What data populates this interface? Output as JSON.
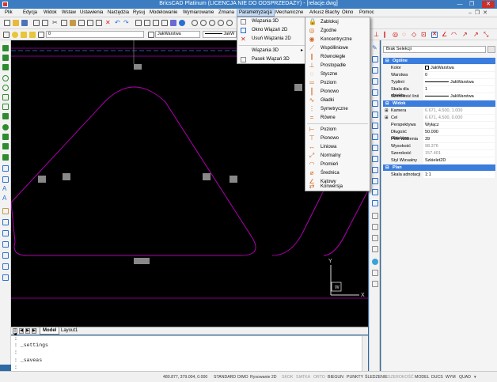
{
  "window": {
    "title": "BricsCAD Platinum (LICENCJA NIE DO ODSPRZEDAŻY) - [relacje.dwg]"
  },
  "menubar": {
    "items": [
      "Plik",
      "Edycja",
      "Widok",
      "Wstaw",
      "Ustawienia",
      "Narzędzia",
      "Rysuj",
      "Modelowanie",
      "Wymiarowanie",
      "Zmiana",
      "Parametryzacja",
      "Mechaniczne",
      "Arkusz Blachy",
      "Okno",
      "Pomoc"
    ],
    "active": "Parametryzacja"
  },
  "toolbar": {
    "layer_value": "0",
    "linetype_value": "JakWarstwa",
    "lineweight_value": "JakW"
  },
  "param_menu": {
    "items": [
      {
        "label": "Wiązania 3D",
        "icon": "constraint-3d-icon"
      },
      {
        "label": "Okno Wiązań 2D",
        "icon": "window-icon"
      },
      {
        "label": "Usuń Wiązania 2D",
        "icon": "delete-icon"
      },
      {
        "label": "Wiązania 3D",
        "icon": "constraint-3d-icon",
        "submenu": true
      },
      {
        "label": "Pasek Wiązań 3D",
        "icon": "toolbar-icon"
      }
    ]
  },
  "constraint_submenu": {
    "items": [
      "Zablokuj",
      "Zgodne",
      "Koncentryczne",
      "Współliniowe",
      "Równoległe",
      "Prostopadłe",
      "Styczne",
      "Poziom",
      "Pionowo",
      "Gładki",
      "Symetryczne",
      "Równe",
      "Poziom",
      "Pionowo",
      "Liniowa",
      "Normalny",
      "Promień",
      "Średnica",
      "Kątowy",
      "Konwersja"
    ]
  },
  "properties": {
    "selection": "Brak Selekcji",
    "sections": [
      {
        "title": "Ogólne",
        "rows": [
          {
            "key": "Kolor",
            "value": "JakWarstwa",
            "swatch": true
          },
          {
            "key": "Warstwa",
            "value": "0"
          },
          {
            "key": "Typlinii",
            "value": "JakWarstwa",
            "line": true
          },
          {
            "key": "Skala dla obiektu",
            "value": "1"
          },
          {
            "key": "Szerokość linii",
            "value": "JakWarstwa",
            "line": true
          }
        ]
      },
      {
        "title": "Widok",
        "rows": [
          {
            "key": "Kamera",
            "value": "6.671, 4.500, 1.000",
            "grey": true,
            "plus": true
          },
          {
            "key": "Cel",
            "value": "6.671, 4.500, 0.000",
            "grey": true,
            "plus": true
          },
          {
            "key": "Perspektywa",
            "value": "Wyłącz"
          },
          {
            "key": "Długość Obiektyw",
            "value": "50.000"
          },
          {
            "key": "Pole widzenia",
            "value": "39"
          },
          {
            "key": "Wysokość",
            "value": "98.376",
            "grey": true
          },
          {
            "key": "Szerokość",
            "value": "157.401",
            "grey": true
          },
          {
            "key": "Styl Wizualny",
            "value": "Szkielet2D"
          }
        ]
      },
      {
        "title": "Plan",
        "rows": [
          {
            "key": "Skala adnotacji",
            "value": "1:1"
          }
        ]
      }
    ]
  },
  "tabs": {
    "model": "Model",
    "layout": "Layout1"
  },
  "command": {
    "lines": [
      ":",
      ": _settings",
      ":",
      ": _saveas",
      ":"
    ]
  },
  "status": {
    "coords": "480.877, 379.004, 0.000",
    "items": [
      {
        "label": "STANDARD",
        "on": true
      },
      {
        "label": "DIMO",
        "on": true
      },
      {
        "label": "Rysowanie 2D",
        "on": true
      },
      {
        "label": "SKOK",
        "on": false
      },
      {
        "label": "SIATKA",
        "on": false
      },
      {
        "label": "ORTO",
        "on": false
      },
      {
        "label": "BIEGUN",
        "on": true
      },
      {
        "label": "PUNKTY",
        "on": true
      },
      {
        "label": "ŚLEDZENIE",
        "on": true
      },
      {
        "label": "SZEROKOŚĆ",
        "on": false
      },
      {
        "label": "MODEL",
        "on": true
      },
      {
        "label": "DUCS",
        "on": true
      },
      {
        "label": "WYM",
        "on": true
      },
      {
        "label": "QUAD",
        "on": true
      }
    ]
  },
  "ucs": {
    "x": "X",
    "y": "Y",
    "w": "W"
  },
  "colors": {
    "accent": "#3c7dc2",
    "section": "#3b7ddd",
    "geometry": "#b000b0",
    "canvas": "#000000"
  }
}
